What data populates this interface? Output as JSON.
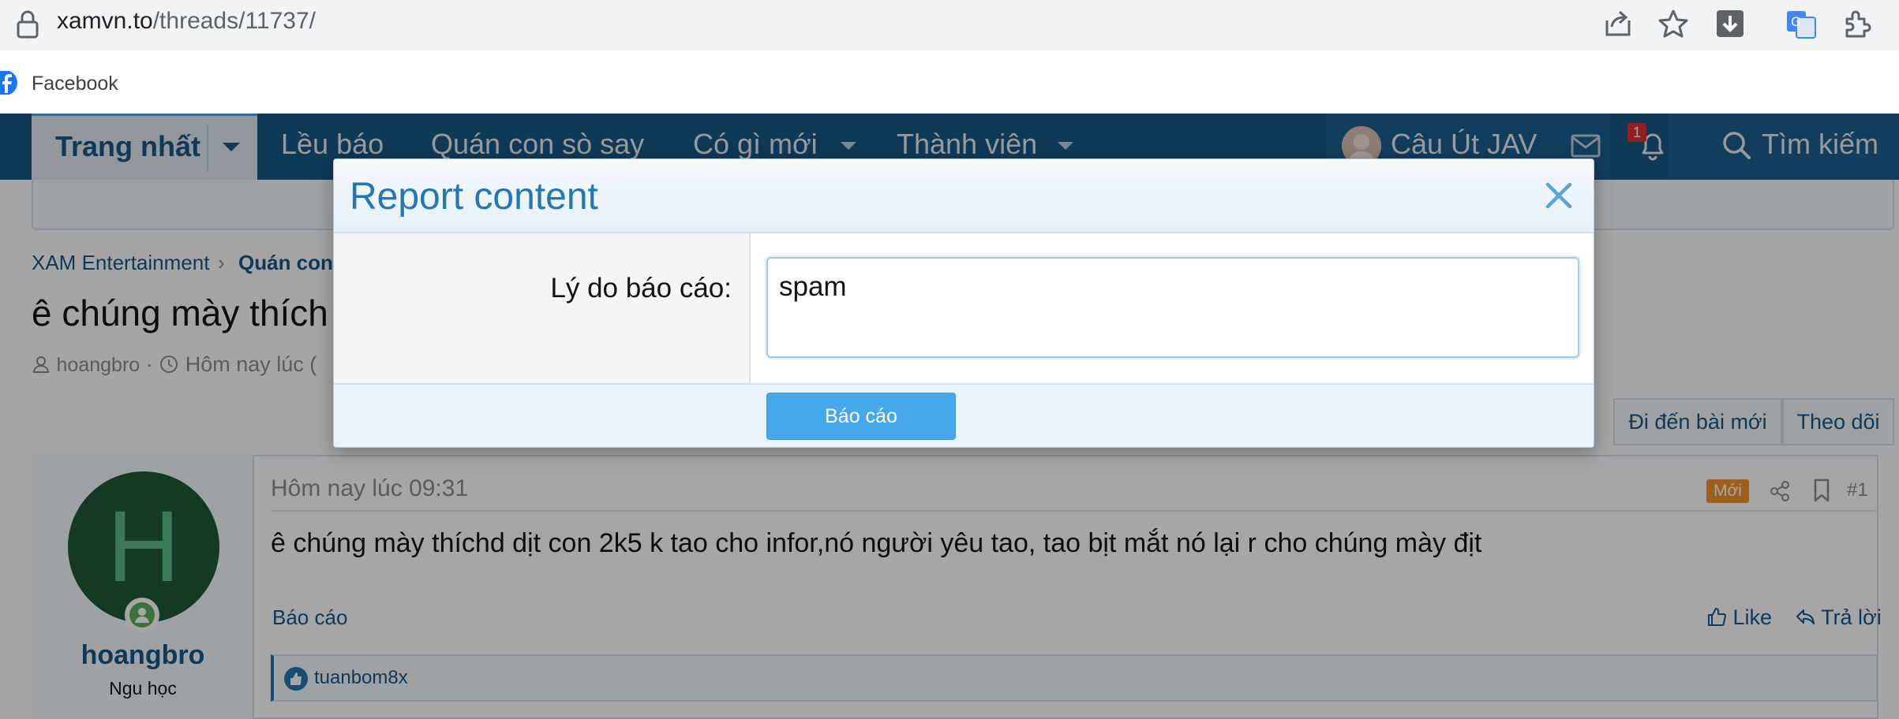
{
  "browser": {
    "url_host": "xamvn.to",
    "url_path": "/threads/11737/",
    "bookmark_facebook": "Facebook"
  },
  "nav": {
    "home": "Trang nhất",
    "items": [
      "Lều báo",
      "Quán con sò say",
      "Có gì mới",
      "Thành viên"
    ],
    "account": "Câu Út JAV",
    "notification_count": "1",
    "search": "Tìm kiếm"
  },
  "page": {
    "breadcrumb_1": "XAM Entertainment",
    "breadcrumb_2": "Quán con",
    "thread_title_visible": "ê chúng mày thích",
    "meta_author": "hoangbro",
    "meta_time_visible": "Hôm nay lúc ("
  },
  "buttons": {
    "go_newest": "Đi đến bài mới",
    "follow": "Theo dõi"
  },
  "post": {
    "username": "hoangbro",
    "avatar_letter": "H",
    "user_title": "Ngu học",
    "time": "Hôm nay lúc 09:31",
    "badge_new": "Mới",
    "post_number": "#1",
    "body": "ê chúng mày thíchd dịt con 2k5 k tao cho infor,nó người yêu tao, tao bịt mắt nó lại r cho chúng mày địt",
    "report": "Báo cáo",
    "like": "Like",
    "reply": "Trả lời",
    "reaction_user": "tuanbom8x"
  },
  "modal": {
    "title": "Report content",
    "label": "Lý do báo cáo:",
    "reason_value": "spam",
    "submit": "Báo cáo"
  },
  "colors": {
    "nav_bg": "#185886",
    "accent": "#2577b1",
    "button": "#47a7eb",
    "new_badge": "#f0922b"
  }
}
